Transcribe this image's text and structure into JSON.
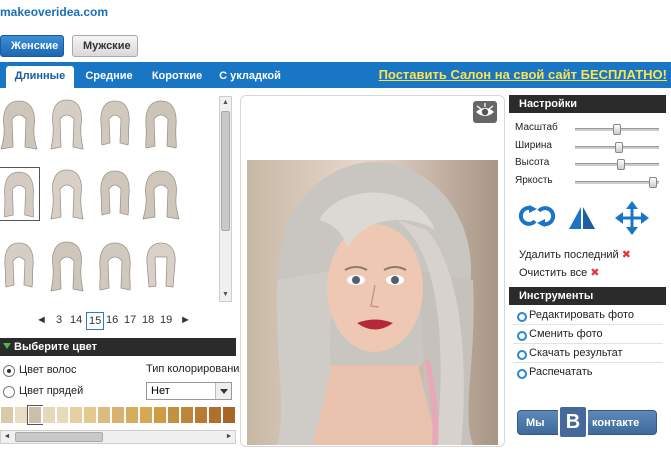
{
  "site": {
    "name": "makeoveridea.com"
  },
  "gender": {
    "active": "Женские",
    "inactive": "Мужские"
  },
  "tabs": [
    {
      "label": "Длинные",
      "active": true
    },
    {
      "label": "Средние",
      "active": false
    },
    {
      "label": "Короткие",
      "active": false
    },
    {
      "label": "С укладкой",
      "active": false
    }
  ],
  "promo": "Поставить Салон на свой сайт БЕСПЛАТНО!",
  "pager": {
    "pages": [
      "3",
      "14",
      "15",
      "16",
      "17",
      "18",
      "19"
    ],
    "current": "15"
  },
  "color_section": {
    "title": "Выберите цвет",
    "hair_color": "Цвет волос",
    "strands_color": "Цвет прядей",
    "coloring_type_label": "Тип колорирования",
    "coloring_type_value": "Нет"
  },
  "swatches": [
    "#d9c9a8",
    "#e9dcc4",
    "#cbbfa9",
    "#e8d8ba",
    "#ead9b6",
    "#e6cfa2",
    "#e4c98f",
    "#dcbc7c",
    "#d8b36f",
    "#d6ac5f",
    "#d8a752",
    "#cf9b45",
    "#c48f40",
    "#bf853a",
    "#b97a33",
    "#b06f2c",
    "#a96527"
  ],
  "settings": {
    "title": "Настройки",
    "sliders": [
      {
        "label": "Масштаб",
        "value": 0.5
      },
      {
        "label": "Ширина",
        "value": 0.52
      },
      {
        "label": "Высота",
        "value": 0.55
      },
      {
        "label": "Яркость",
        "value": 0.98
      }
    ],
    "delete_last": "Удалить последний",
    "clear_all": "Очистить все"
  },
  "tools": {
    "title": "Инструменты",
    "items": [
      "Редактировать фото",
      "Сменить фото",
      "Скачать результат",
      "Распечатать"
    ]
  },
  "vk": {
    "left": "Мы",
    "letter": "В",
    "right": "контакте"
  },
  "colors": {
    "accent": "#1976c5",
    "promo": "#ffe24a",
    "dark_header": "#2b2b2b",
    "remove": "#e23838"
  }
}
